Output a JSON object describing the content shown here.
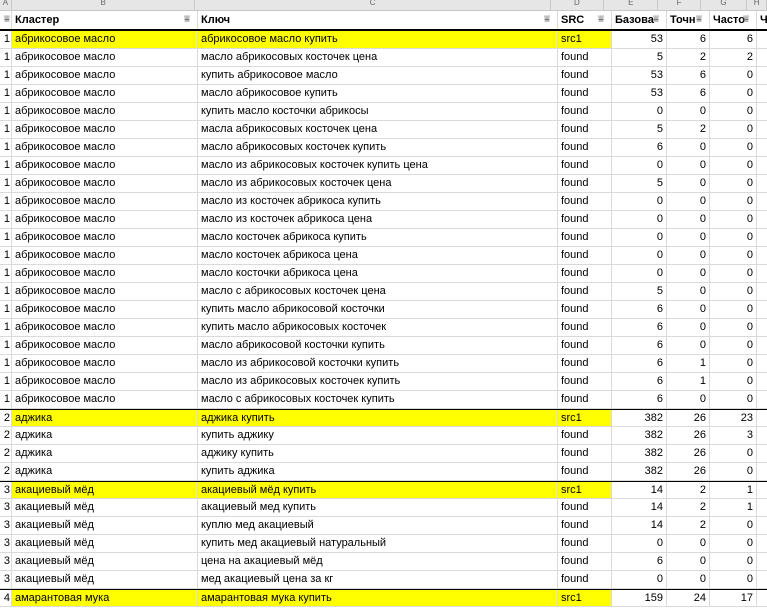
{
  "column_letters": [
    "A",
    "B",
    "C",
    "D",
    "E",
    "F",
    "G",
    "H"
  ],
  "headers": [
    "",
    "Кластер",
    "Ключ",
    "SRC",
    "Базова",
    "Точн",
    "Часто",
    "Ча"
  ],
  "rows": [
    {
      "g": "1",
      "cluster": "абрикосовое масло",
      "key": "абрикосовое масло купить",
      "src": "src1",
      "base": "53",
      "exact": "6",
      "freq": "6",
      "hl": true,
      "start": true
    },
    {
      "g": "1",
      "cluster": "абрикосовое масло",
      "key": "масло абрикосовых косточек цена",
      "src": "found",
      "base": "5",
      "exact": "2",
      "freq": "2"
    },
    {
      "g": "1",
      "cluster": "абрикосовое масло",
      "key": "купить абрикосовое масло",
      "src": "found",
      "base": "53",
      "exact": "6",
      "freq": "0"
    },
    {
      "g": "1",
      "cluster": "абрикосовое масло",
      "key": "масло абрикосовое купить",
      "src": "found",
      "base": "53",
      "exact": "6",
      "freq": "0"
    },
    {
      "g": "1",
      "cluster": "абрикосовое масло",
      "key": "купить масло косточки абрикосы",
      "src": "found",
      "base": "0",
      "exact": "0",
      "freq": "0"
    },
    {
      "g": "1",
      "cluster": "абрикосовое масло",
      "key": "масла абрикосовых косточек цена",
      "src": "found",
      "base": "5",
      "exact": "2",
      "freq": "0"
    },
    {
      "g": "1",
      "cluster": "абрикосовое масло",
      "key": "масло абрикосовых косточек купить",
      "src": "found",
      "base": "6",
      "exact": "0",
      "freq": "0"
    },
    {
      "g": "1",
      "cluster": "абрикосовое масло",
      "key": "масло из абрикосовых косточек купить цена",
      "src": "found",
      "base": "0",
      "exact": "0",
      "freq": "0"
    },
    {
      "g": "1",
      "cluster": "абрикосовое масло",
      "key": "масло из абрикосовых косточек цена",
      "src": "found",
      "base": "5",
      "exact": "0",
      "freq": "0"
    },
    {
      "g": "1",
      "cluster": "абрикосовое масло",
      "key": "масло из косточек абрикоса купить",
      "src": "found",
      "base": "0",
      "exact": "0",
      "freq": "0"
    },
    {
      "g": "1",
      "cluster": "абрикосовое масло",
      "key": "масло из косточек абрикоса цена",
      "src": "found",
      "base": "0",
      "exact": "0",
      "freq": "0"
    },
    {
      "g": "1",
      "cluster": "абрикосовое масло",
      "key": "масло косточек абрикоса купить",
      "src": "found",
      "base": "0",
      "exact": "0",
      "freq": "0"
    },
    {
      "g": "1",
      "cluster": "абрикосовое масло",
      "key": "масло косточек абрикоса цена",
      "src": "found",
      "base": "0",
      "exact": "0",
      "freq": "0"
    },
    {
      "g": "1",
      "cluster": "абрикосовое масло",
      "key": "масло косточки абрикоса цена",
      "src": "found",
      "base": "0",
      "exact": "0",
      "freq": "0"
    },
    {
      "g": "1",
      "cluster": "абрикосовое масло",
      "key": "масло с абрикосовых косточек цена",
      "src": "found",
      "base": "5",
      "exact": "0",
      "freq": "0"
    },
    {
      "g": "1",
      "cluster": "абрикосовое масло",
      "key": "купить масло абрикосовой косточки",
      "src": "found",
      "base": "6",
      "exact": "0",
      "freq": "0"
    },
    {
      "g": "1",
      "cluster": "абрикосовое масло",
      "key": "купить масло абрикосовых косточек",
      "src": "found",
      "base": "6",
      "exact": "0",
      "freq": "0"
    },
    {
      "g": "1",
      "cluster": "абрикосовое масло",
      "key": "масло абрикосовой косточки купить",
      "src": "found",
      "base": "6",
      "exact": "0",
      "freq": "0"
    },
    {
      "g": "1",
      "cluster": "абрикосовое масло",
      "key": "масло из абрикосовой косточки купить",
      "src": "found",
      "base": "6",
      "exact": "1",
      "freq": "0"
    },
    {
      "g": "1",
      "cluster": "абрикосовое масло",
      "key": "масло из абрикосовых косточек купить",
      "src": "found",
      "base": "6",
      "exact": "1",
      "freq": "0"
    },
    {
      "g": "1",
      "cluster": "абрикосовое масло",
      "key": "масло с абрикосовых косточек купить",
      "src": "found",
      "base": "6",
      "exact": "0",
      "freq": "0"
    },
    {
      "g": "2",
      "cluster": "аджика",
      "key": "аджика купить",
      "src": "src1",
      "base": "382",
      "exact": "26",
      "freq": "23",
      "hl": true,
      "start": true
    },
    {
      "g": "2",
      "cluster": "аджика",
      "key": "купить аджику",
      "src": "found",
      "base": "382",
      "exact": "26",
      "freq": "3"
    },
    {
      "g": "2",
      "cluster": "аджика",
      "key": "аджику купить",
      "src": "found",
      "base": "382",
      "exact": "26",
      "freq": "0"
    },
    {
      "g": "2",
      "cluster": "аджика",
      "key": "купить аджика",
      "src": "found",
      "base": "382",
      "exact": "26",
      "freq": "0"
    },
    {
      "g": "3",
      "cluster": "акациевый мёд",
      "key": "акациевый мёд купить",
      "src": "src1",
      "base": "14",
      "exact": "2",
      "freq": "1",
      "hl": true,
      "start": true
    },
    {
      "g": "3",
      "cluster": "акациевый мёд",
      "key": "акациевый мед купить",
      "src": "found",
      "base": "14",
      "exact": "2",
      "freq": "1"
    },
    {
      "g": "3",
      "cluster": "акациевый мёд",
      "key": "куплю мед акациевый",
      "src": "found",
      "base": "14",
      "exact": "2",
      "freq": "0"
    },
    {
      "g": "3",
      "cluster": "акациевый мёд",
      "key": "купить мед акациевый натуральный",
      "src": "found",
      "base": "0",
      "exact": "0",
      "freq": "0"
    },
    {
      "g": "3",
      "cluster": "акациевый мёд",
      "key": "цена на акациевый мёд",
      "src": "found",
      "base": "6",
      "exact": "0",
      "freq": "0"
    },
    {
      "g": "3",
      "cluster": "акациевый мёд",
      "key": "мед акациевый цена за кг",
      "src": "found",
      "base": "0",
      "exact": "0",
      "freq": "0"
    },
    {
      "g": "4",
      "cluster": "амарантовая мука",
      "key": "амарантовая мука купить",
      "src": "src1",
      "base": "159",
      "exact": "24",
      "freq": "17",
      "hl": true,
      "start": true
    }
  ]
}
